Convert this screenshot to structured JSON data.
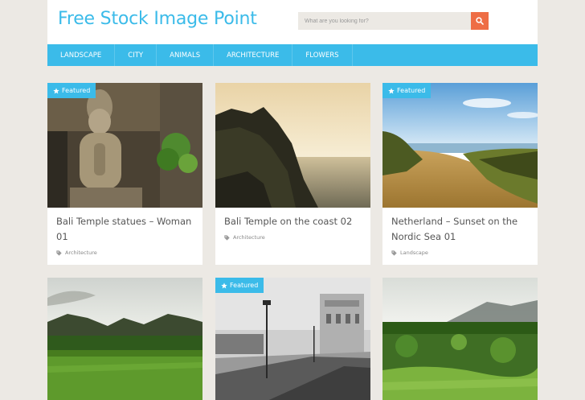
{
  "site": {
    "title": "Free Stock Image Point"
  },
  "search": {
    "placeholder": "What are you looking for?"
  },
  "nav": {
    "items": [
      "LANDSCAPE",
      "CITY",
      "ANIMALS",
      "ARCHITECTURE",
      "FLOWERS"
    ]
  },
  "icons": {
    "search": "magnifier-icon",
    "featured": "star-icon",
    "tag": "tag-icon"
  },
  "colors": {
    "brand": "#3bbbe9",
    "search_button": "#ee6d45",
    "background": "#ece9e4"
  },
  "posts": [
    {
      "title": "Bali Temple statues – Woman 01",
      "category": "Architecture",
      "featured": true,
      "badge": "Featured"
    },
    {
      "title": "Bali Temple on the coast 02",
      "category": "Architecture",
      "featured": false
    },
    {
      "title": "Netherland – Sunset on the Nordic Sea 01",
      "category": "Landscape",
      "featured": true,
      "badge": "Featured"
    },
    {
      "featured": false
    },
    {
      "featured": true,
      "badge": "Featured"
    },
    {
      "featured": false
    }
  ]
}
